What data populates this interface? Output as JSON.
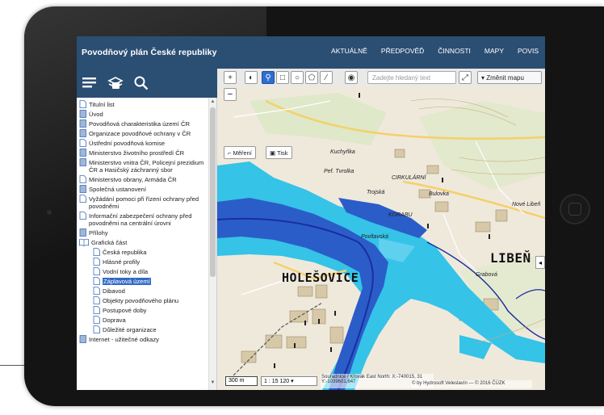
{
  "header": {
    "title": "Povodňový plán České republiky",
    "nav": [
      "AKTUÁLNĚ",
      "PŘEDPOVĚĎ",
      "ČINNOSTI",
      "MAPY",
      "POVIS"
    ]
  },
  "toolbar": {
    "icons": [
      "menu-icon",
      "layers-icon",
      "search-icon"
    ]
  },
  "toc": {
    "items": [
      {
        "label": "Titulní list",
        "icon": "page"
      },
      {
        "label": "Úvod",
        "icon": "doc"
      },
      {
        "label": "Povodňová charakteristika území ČR",
        "icon": "doc"
      },
      {
        "label": "Organizace povodňové ochrany v ČR",
        "icon": "doc"
      },
      {
        "label": "Ústřední povodňová komise",
        "icon": "page"
      },
      {
        "label": "Ministerstvo životního prostředí ČR",
        "icon": "doc"
      },
      {
        "label": "Ministerstvo vnitra ČR, Policejní prezidium ČR a Hasičský záchranný sbor",
        "icon": "doc"
      },
      {
        "label": "Ministerstvo obrany, Armáda ČR",
        "icon": "page"
      },
      {
        "label": "Společná ustanovení",
        "icon": "doc"
      },
      {
        "label": "Vyžádání pomoci při řízení ochrany před povodněmi",
        "icon": "page"
      },
      {
        "label": "Informační zabezpečení ochrany před povodněmi na centrální úrovni",
        "icon": "page"
      },
      {
        "label": "Přílohy",
        "icon": "doc"
      },
      {
        "label": "Grafická část",
        "icon": "book"
      }
    ],
    "subitems": [
      {
        "label": "Česká republika",
        "selected": false
      },
      {
        "label": "Hlásné profily",
        "selected": false
      },
      {
        "label": "Vodní toky a díla",
        "selected": false
      },
      {
        "label": "Záplavová území",
        "selected": true
      },
      {
        "label": "Dibavod",
        "selected": false
      },
      {
        "label": "Objekty povodňového plánu",
        "selected": false
      },
      {
        "label": "Postupové doby",
        "selected": false
      },
      {
        "label": "Doprava",
        "selected": false
      },
      {
        "label": "Důležité organizace",
        "selected": false
      }
    ],
    "last_item": "Internet - užitečné odkazy"
  },
  "map": {
    "zoom_in": "+",
    "zoom_out": "−",
    "search_placeholder": "Zadejte hledaný text",
    "change_map": "Změnit mapu",
    "measure": "Měření",
    "print": "Tisk",
    "scale_bar": "300 m",
    "scale": "1 : 15 120",
    "coords": "Souřadnice / Křovák East North: X:-740015, 31  Y:-1039601,647",
    "attribution": "© by Hydrosoft Veleslavín — © 2016 ČÚZK",
    "labels": {
      "holesovice": "HOLEŠOVICE",
      "liben": "LIBEŇ",
      "kuchynka": "Kuchyňka",
      "bulovka": "Bulovka",
      "trojska": "Trojská",
      "povltavska": "Povltavská",
      "tvrolka": "Pef. Tvrolka",
      "nove_liben": "Nové Libeň",
      "grabova": "Grabová",
      "korabu": "KORABU",
      "cirkularni": "CIRKULÁRNÍ"
    },
    "colors": {
      "flood_light": "#35c3e8",
      "flood_dark": "#2b5dc8",
      "river_line": "#1a2fa0",
      "topo_bg": "#efe9dc"
    }
  }
}
